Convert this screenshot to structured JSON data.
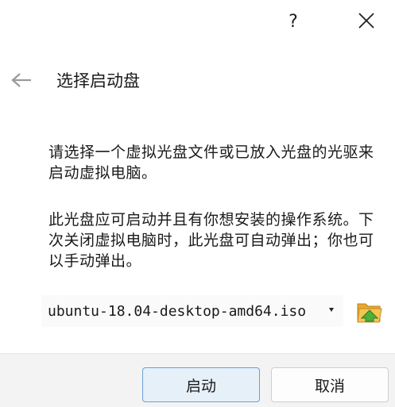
{
  "titlebar": {
    "help_label": "?",
    "help_icon": "question-mark-icon",
    "close_icon": "close-icon"
  },
  "header": {
    "back_icon": "arrow-left-icon",
    "title": "选择启动盘"
  },
  "content": {
    "paragraph_1": "请选择一个虚拟光盘文件或已放入光盘的光驱来启动虚拟电脑。",
    "paragraph_2": "此光盘应可启动并且有你想安装的操作系统。下次关闭虚拟电脑时，此光盘可自动弹出；你也可以手动弹出。"
  },
  "disk_selector": {
    "selected_value": "ubuntu-18.04-desktop-amd64.iso",
    "dropdown_icon": "chevron-down-icon",
    "folder_icon": "folder-open-icon"
  },
  "footer": {
    "start_label": "启动",
    "cancel_label": "取消"
  },
  "colors": {
    "primary_button_bg": "#e6f0f9",
    "primary_button_border": "#6aa0d6",
    "footer_bg": "#f3f3f3",
    "folder_yellow": "#f2b63c",
    "folder_green": "#4caf3c"
  }
}
